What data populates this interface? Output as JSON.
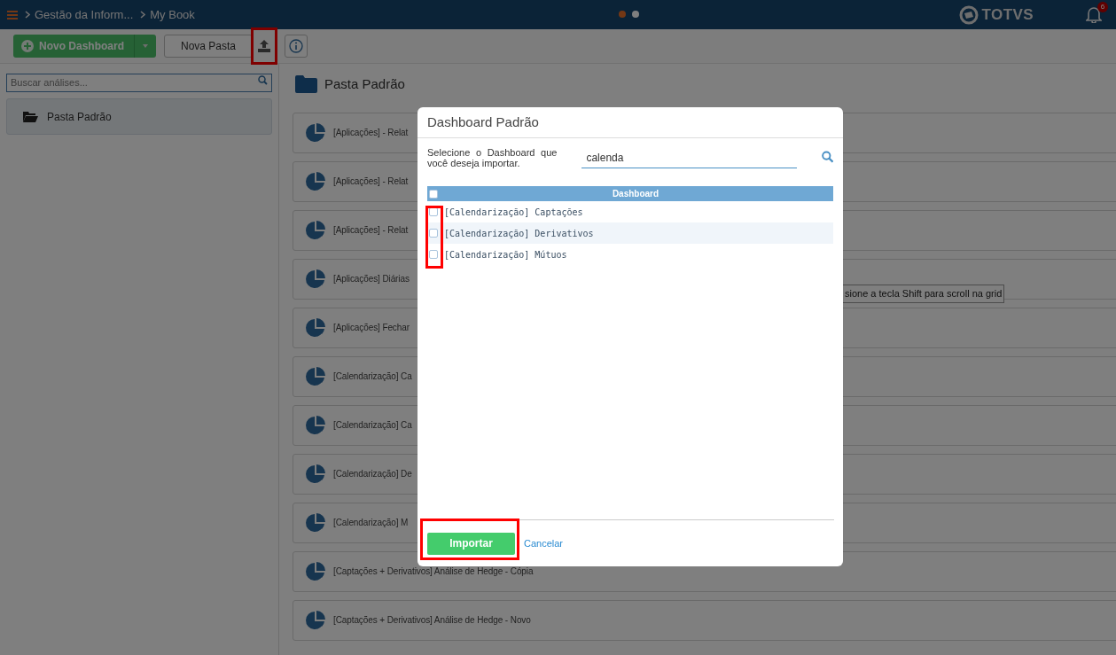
{
  "top_bar": {
    "breadcrumbs": [
      "Gestão da Inform...",
      "My Book"
    ],
    "carousel_dots": [
      {
        "selected": true
      },
      {
        "selected": false
      }
    ],
    "logo": "TOTVS",
    "notifications_badge": "6"
  },
  "toolbar": {
    "new_dashboard": "Novo Dashboard",
    "new_folder": "Nova Pasta"
  },
  "sidebar": {
    "search_placeholder": "Buscar análises...",
    "items": [
      {
        "label": "Pasta Padrão",
        "selected": true
      }
    ]
  },
  "content": {
    "folder_title": "Pasta Padrão",
    "items": [
      {
        "label": "[Aplicações] - Relat"
      },
      {
        "label": "[Aplicações] - Relat"
      },
      {
        "label": "[Aplicações] - Relat"
      },
      {
        "label": "[Aplicações] Diárias"
      },
      {
        "label": "[Aplicações] Fechar"
      },
      {
        "label": "[Calendarização] Ca"
      },
      {
        "label": "[Calendarização] Ca"
      },
      {
        "label": "[Calendarização] De"
      },
      {
        "label": "[Calendarização] M"
      },
      {
        "label": "[Captações + Derivativos] Análise de Hedge - Cópia"
      },
      {
        "label": "[Captações + Derivativos] Análise de Hedge - Novo"
      }
    ],
    "tooltip": "sione a tecla Shift para scroll na grid"
  },
  "dialog": {
    "title": "Dashboard Padrão",
    "instruction": "Selecione o Dashboard que você deseja importar.",
    "search_value": "calenda",
    "table": {
      "column": "Dashboard",
      "select_all_checked": false,
      "rows": [
        {
          "label": "[Calendarização] Captações",
          "checked": false
        },
        {
          "label": "[Calendarização] Derivativos",
          "checked": false
        },
        {
          "label": "[Calendarização] Mútuos",
          "checked": false
        }
      ]
    },
    "buttons": {
      "import": "Importar",
      "cancel": "Cancelar"
    }
  }
}
